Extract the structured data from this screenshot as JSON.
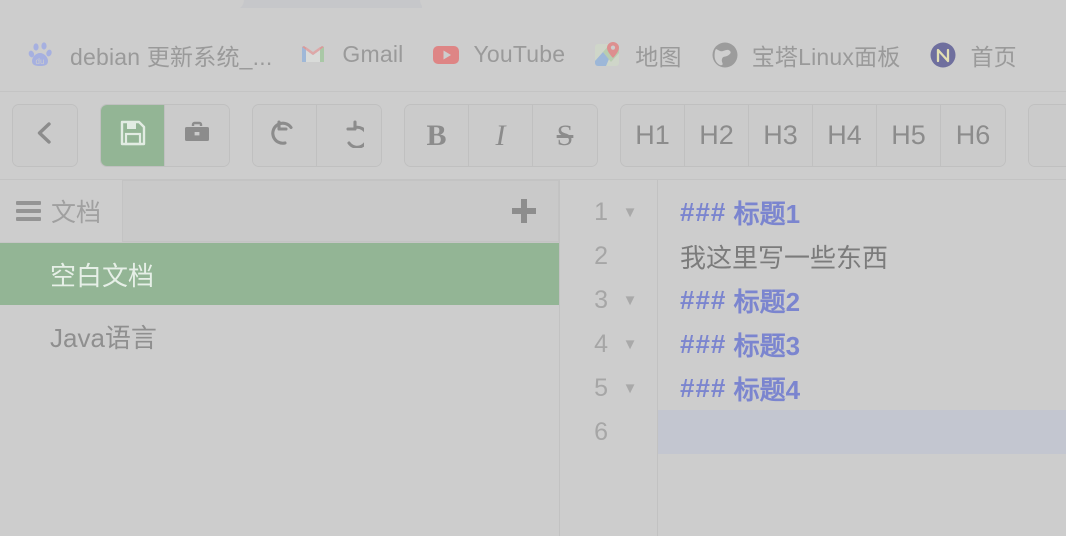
{
  "browser": {
    "bookmarks": [
      {
        "icon": "baidu-icon",
        "label": "debian 更新系统_..."
      },
      {
        "icon": "gmail-icon",
        "label": "Gmail"
      },
      {
        "icon": "youtube-icon",
        "label": "YouTube"
      },
      {
        "icon": "google-maps-icon",
        "label": "地图"
      },
      {
        "icon": "globe-icon",
        "label": "宝塔Linux面板"
      },
      {
        "icon": "nginx-icon",
        "label": "首页"
      }
    ]
  },
  "toolbar": {
    "groups": [
      {
        "name": "navigation",
        "buttons": [
          {
            "name": "back-button",
            "icon": "chevron-left-icon",
            "label": "‹",
            "style": "sym",
            "active": false
          }
        ]
      },
      {
        "name": "file-actions",
        "buttons": [
          {
            "name": "save-button",
            "icon": "floppy-disk-icon",
            "label": "💾",
            "style": "sym",
            "active": true
          },
          {
            "name": "toolbox-button",
            "icon": "briefcase-icon",
            "label": "💼",
            "style": "sym",
            "active": false
          }
        ]
      },
      {
        "name": "history-actions",
        "buttons": [
          {
            "name": "undo-button",
            "icon": "undo-arrow-icon",
            "label": "↺",
            "style": "sym",
            "active": false
          },
          {
            "name": "redo-button",
            "icon": "redo-arrow-icon",
            "label": "↻",
            "style": "sym",
            "active": false
          }
        ]
      },
      {
        "name": "text-style",
        "buttons": [
          {
            "name": "bold-button",
            "icon": "bold-icon",
            "label": "B",
            "style": "b",
            "active": false
          },
          {
            "name": "italic-button",
            "icon": "italic-icon",
            "label": "I",
            "style": "i",
            "active": false
          },
          {
            "name": "strikethrough-button",
            "icon": "strikethrough-icon",
            "label": "S",
            "style": "s",
            "active": false
          }
        ]
      },
      {
        "name": "headings",
        "buttons": [
          {
            "name": "heading-1-button",
            "icon": "h1-icon",
            "label": "H1",
            "style": "h",
            "active": false
          },
          {
            "name": "heading-2-button",
            "icon": "h2-icon",
            "label": "H2",
            "style": "h",
            "active": false
          },
          {
            "name": "heading-3-button",
            "icon": "h3-icon",
            "label": "H3",
            "style": "h",
            "active": false
          },
          {
            "name": "heading-4-button",
            "icon": "h4-icon",
            "label": "H4",
            "style": "h",
            "active": false
          },
          {
            "name": "heading-5-button",
            "icon": "h5-icon",
            "label": "H5",
            "style": "h",
            "active": false
          },
          {
            "name": "heading-6-button",
            "icon": "h6-icon",
            "label": "H6",
            "style": "h",
            "active": false
          }
        ]
      },
      {
        "name": "overflow",
        "buttons": [
          {
            "name": "overflow-button",
            "icon": "more-icon",
            "label": "",
            "style": "h",
            "active": false
          }
        ]
      }
    ]
  },
  "sidebar": {
    "menu_icon": "hamburger-menu-icon",
    "title": "文档",
    "search_value": "",
    "search_placeholder": "",
    "add_icon": "plus-icon",
    "documents": [
      {
        "label": "空白文档",
        "active": true
      },
      {
        "label": "Java语言",
        "active": false
      }
    ]
  },
  "editor": {
    "lines": [
      {
        "number": "1",
        "foldable": true,
        "active": false,
        "marker": "###",
        "text": " 标题1",
        "kind": "heading"
      },
      {
        "number": "2",
        "foldable": false,
        "active": false,
        "marker": "",
        "text": "我这里写一些东西",
        "kind": "text"
      },
      {
        "number": "3",
        "foldable": true,
        "active": false,
        "marker": "###",
        "text": " 标题2",
        "kind": "heading"
      },
      {
        "number": "4",
        "foldable": true,
        "active": false,
        "marker": "###",
        "text": " 标题3",
        "kind": "heading"
      },
      {
        "number": "5",
        "foldable": true,
        "active": false,
        "marker": "###",
        "text": " 标题4",
        "kind": "heading"
      },
      {
        "number": "6",
        "foldable": false,
        "active": true,
        "marker": "",
        "text": "",
        "kind": "text"
      }
    ],
    "fold_glyph": "▼"
  },
  "colors": {
    "accent_green": "#93b595",
    "markdown_blue": "#7b85cf",
    "page_background": "#cdcdcd",
    "active_line": "#c3c6d0",
    "muted_text": "#9a9a9a"
  }
}
